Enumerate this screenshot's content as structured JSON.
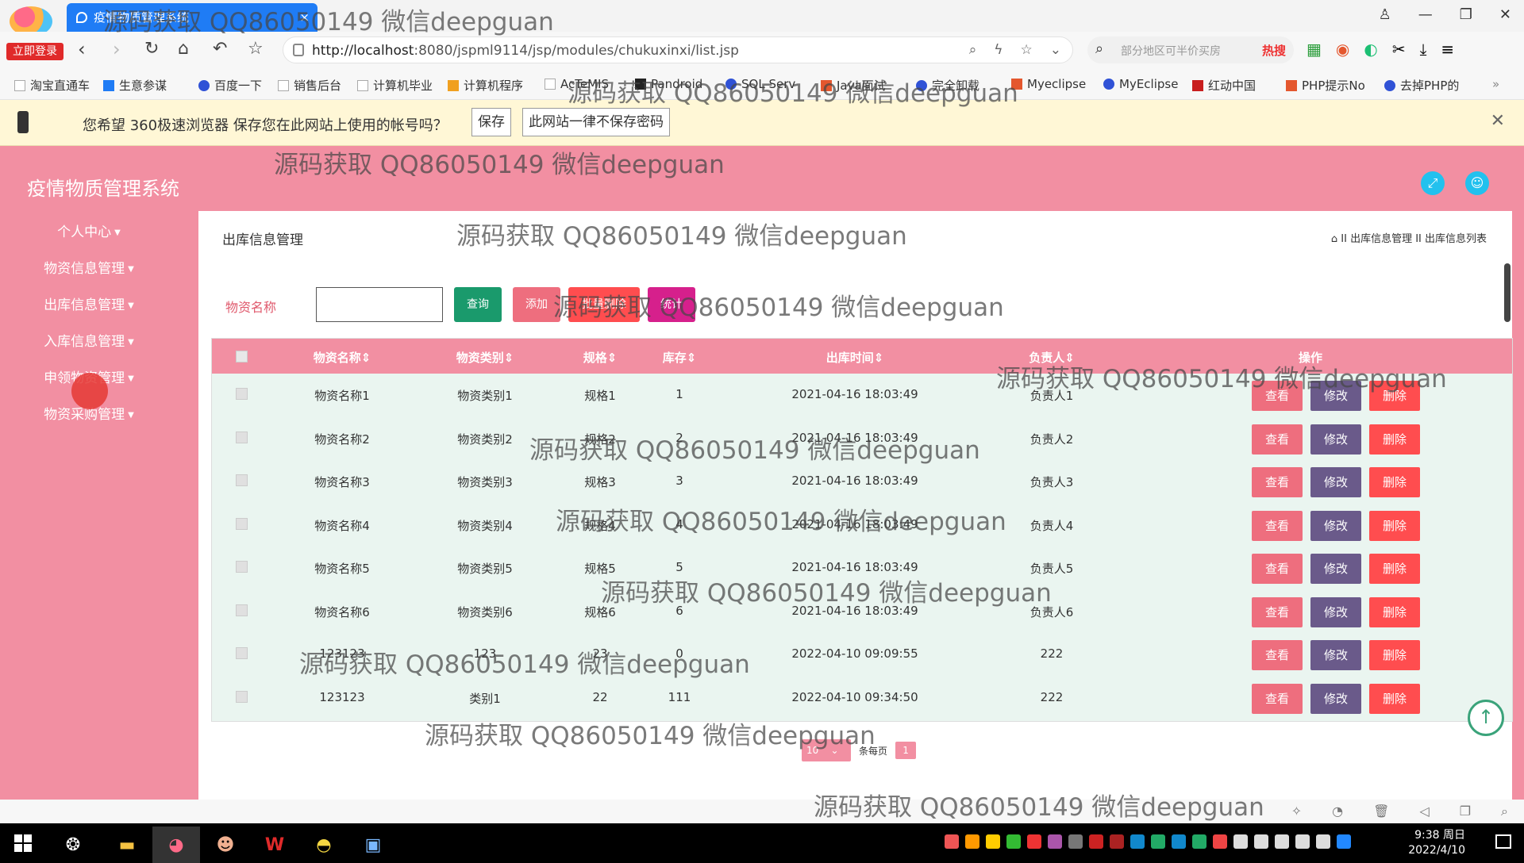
{
  "browser": {
    "tab_title": "疫情物质管理系统",
    "login_badge": "立即登录",
    "url_host": "http://localhost",
    "url_rest": ":8080/jspml9114/jsp/modules/chukuxinxi/list.jsp",
    "search_placeholder": "部分地区可半价买房",
    "search_hot": "热搜",
    "bookmarks": [
      "淘宝直通车",
      "生意参谋",
      "百度一下",
      "销售后台",
      "计算机毕业",
      "计算机程序",
      "AcTeMIS",
      "Pandroid",
      "SQL Serv",
      "Java面试",
      "完全卸载",
      "Myeclipse",
      "MyEclipse",
      "红动中国",
      "PHP提示No",
      "去掉PHP的"
    ],
    "password_bar": {
      "message": "您希望 360极速浏览器 保存您在此网站上使用的帐号吗？",
      "save": "保存",
      "never": "此网站一律不保存密码"
    }
  },
  "app": {
    "title": "疫情物质管理系统",
    "sidebar": [
      "个人中心",
      "物资信息管理",
      "出库信息管理",
      "入库信息管理",
      "申领物资管理",
      "物资采购管理"
    ],
    "page_title": "出库信息管理",
    "breadcrumb": "II 出库信息管理 II 出库信息列表",
    "search": {
      "label": "物资名称",
      "value": ""
    },
    "buttons": {
      "query": "查询",
      "add": "添加",
      "batch_delete": "批量删除",
      "stats": "统计"
    },
    "columns": [
      "物资名称",
      "物资类别",
      "规格",
      "库存",
      "出库时间",
      "负责人",
      "操作"
    ],
    "rows": [
      [
        "物资名称1",
        "物资类别1",
        "规格1",
        "1",
        "2021-04-16 18:03:49",
        "负责人1"
      ],
      [
        "物资名称2",
        "物资类别2",
        "规格2",
        "2",
        "2021-04-16 18:03:49",
        "负责人2"
      ],
      [
        "物资名称3",
        "物资类别3",
        "规格3",
        "3",
        "2021-04-16 18:03:49",
        "负责人3"
      ],
      [
        "物资名称4",
        "物资类别4",
        "规格4",
        "4",
        "2021-04-16 18:03:49",
        "负责人4"
      ],
      [
        "物资名称5",
        "物资类别5",
        "规格5",
        "5",
        "2021-04-16 18:03:49",
        "负责人5"
      ],
      [
        "物资名称6",
        "物资类别6",
        "规格6",
        "6",
        "2021-04-16 18:03:49",
        "负责人6"
      ],
      [
        "123123",
        "123",
        "23",
        "0",
        "2022-04-10 09:09:55",
        "222"
      ],
      [
        "123123",
        "类别1",
        "22",
        "111",
        "2022-04-10 09:34:50",
        "222"
      ]
    ],
    "row_actions": {
      "view": "查看",
      "edit": "修改",
      "delete": "删除"
    },
    "pagination": {
      "page_size": "10",
      "per_page_label": "条每页",
      "current_page": "1"
    }
  },
  "taskbar": {
    "time": "9:38 周日",
    "date": "2022/4/10"
  },
  "watermark": "源码获取 QQ86050149 微信deepguan",
  "colors": {
    "primary": "#f28fa2",
    "query": "#1a9a6c",
    "view": "#ee6e7e",
    "edit": "#6a5a8a",
    "delete": "#ff4d4f",
    "stats": "#d6208c"
  }
}
